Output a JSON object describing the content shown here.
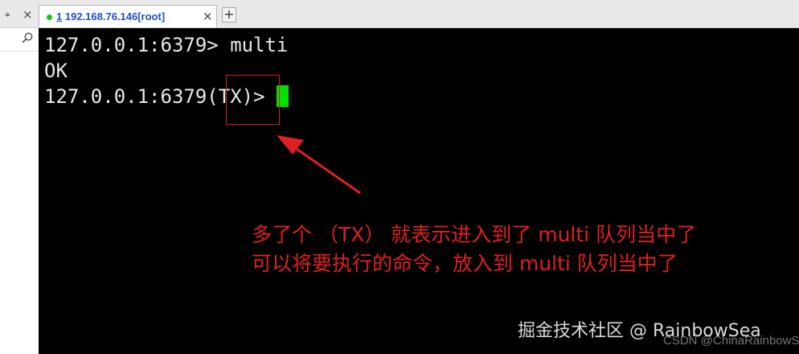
{
  "side_panel": {
    "pin_icon": "pin-icon",
    "close_icon": "close-icon",
    "search_icon": "search-icon"
  },
  "tab": {
    "number": "1",
    "label": "192.168.76.146[root]",
    "close_symbol": "×",
    "add_symbol": "+",
    "status_color": "#19c21e"
  },
  "terminal": {
    "lines": [
      "127.0.0.1:6379> multi",
      "OK",
      "127.0.0.1:6379(TX)>"
    ],
    "cursor_color": "#00e000"
  },
  "annotation": {
    "line1": "多了个 （TX） 就表示进入到了 multi 队列当中了",
    "line2": "可以将要执行的命令，放入到 multi 队列当中了",
    "color": "#e02020"
  },
  "watermark": {
    "primary": "掘金技术社区 @ RainbowSea",
    "secondary": "CSDN @ChinaRainbowSea"
  }
}
